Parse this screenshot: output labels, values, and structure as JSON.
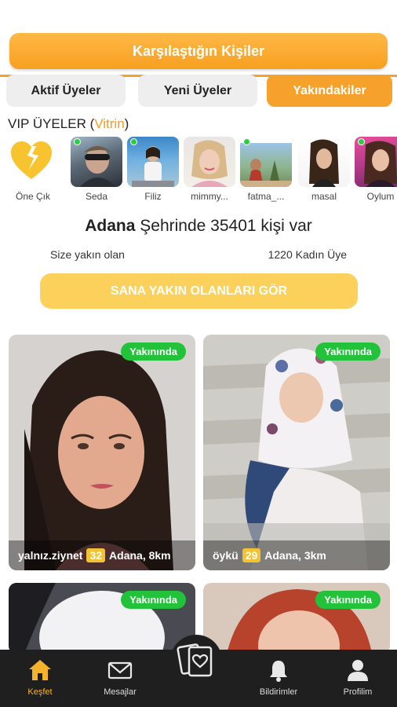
{
  "header": {
    "banner_label": "Karşılaştığın Kişiler"
  },
  "tabs": [
    {
      "label": "Aktif Üyeler",
      "active": false
    },
    {
      "label": "Yeni Üyeler",
      "active": false
    },
    {
      "label": "Yakındakiler",
      "active": true
    }
  ],
  "vip": {
    "title_prefix": "VIP ÜYELER (",
    "title_vitrin": "Vitrin",
    "title_suffix": ")",
    "promote_label": "Öne Çık",
    "members": [
      {
        "name": "Seda",
        "online": true
      },
      {
        "name": "Filiz",
        "online": true
      },
      {
        "name": "mimmy...",
        "online": false
      },
      {
        "name": "fatma_...",
        "online": true
      },
      {
        "name": "masal",
        "online": false
      },
      {
        "name": "Oylum",
        "online": true
      }
    ]
  },
  "city_summary": {
    "city": "Adana",
    "text_mid": " Şehrinde ",
    "count": "35401",
    "text_end": " kişi var",
    "near_label": "Size yakın olan",
    "female_label": "1220 Kadın Üye"
  },
  "near_button": {
    "label": "SANA YAKIN OLANLARI GÖR"
  },
  "cards": [
    {
      "badge": "Yakınında",
      "username": "yalnız.ziynet",
      "age": "32",
      "location": "Adana, 8km"
    },
    {
      "badge": "Yakınında",
      "username": "öykü",
      "age": "29",
      "location": "Adana, 3km"
    },
    {
      "badge": "Yakınında"
    },
    {
      "badge": "Yakınında"
    }
  ],
  "bottom_nav": [
    {
      "label": "Keşfet",
      "icon": "home-icon",
      "active": true
    },
    {
      "label": "Mesajlar",
      "icon": "mail-icon",
      "active": false
    },
    {
      "label": "",
      "icon": "cards-heart-icon",
      "active": false
    },
    {
      "label": "Bildirimler",
      "icon": "bell-icon",
      "active": false
    },
    {
      "label": "Profilim",
      "icon": "user-icon",
      "active": false
    }
  ],
  "colors": {
    "accent": "#f5a12b",
    "online": "#2ecc40",
    "near_badge": "#22c33a",
    "age_badge": "#f1c232",
    "nav_bg": "#1f1f1f"
  }
}
